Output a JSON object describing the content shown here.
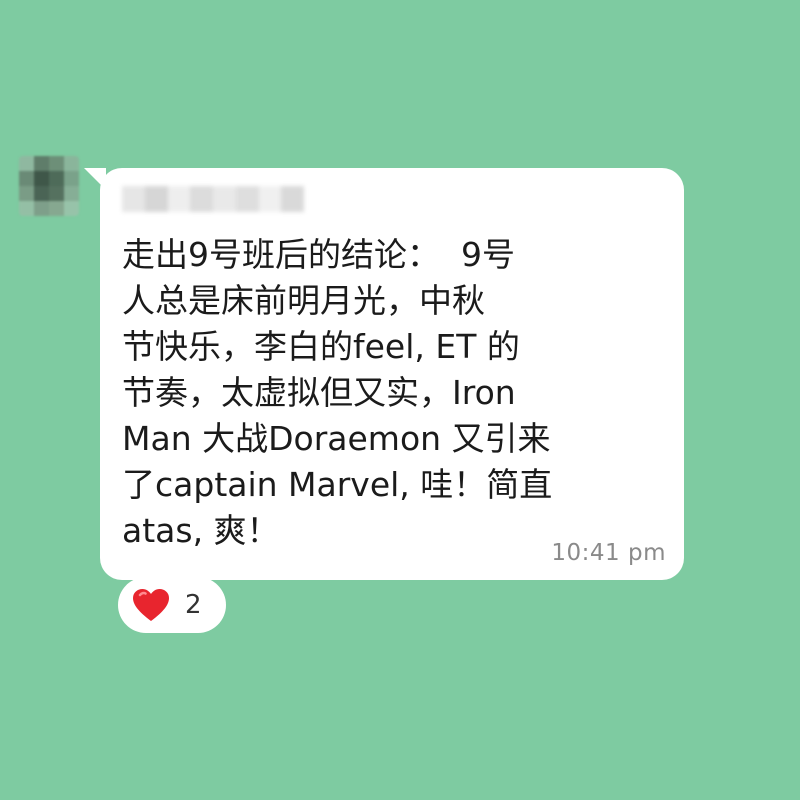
{
  "message": {
    "lines": [
      "走出9号班后的结论：  9号",
      "人总是床前明月光，中秋",
      "节快乐，李白的feel, ET 的",
      "节奏，太虚拟但又实，Iron",
      "Man 大战Doraemon 又引来",
      "了captain Marvel, 哇！简直",
      "atas, 爽！"
    ],
    "time": "10:41 pm"
  },
  "reaction": {
    "icon": "heart-icon",
    "count": "2"
  },
  "colors": {
    "background": "#7ecba1",
    "bubble": "#ffffff",
    "heart": "#e8252e"
  }
}
